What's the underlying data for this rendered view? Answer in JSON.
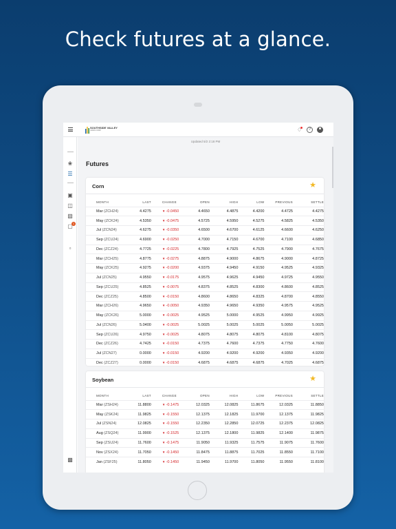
{
  "headline": "Check futures at a glance.",
  "app": {
    "logo_text": "SOUTHSIDE VALLEY",
    "logo_sub": "GRAIN CORP.",
    "updated": "Updated 5/2 2:18 PM",
    "page_title": "Futures"
  },
  "colors": {
    "accent": "#1462a6",
    "negative": "#d3272b",
    "star": "#f2b824",
    "badge": "#e0551f"
  },
  "icons": {
    "topbar": [
      "menu-icon",
      "bell-icon",
      "help-icon",
      "user-icon"
    ],
    "sidenav": [
      "leaf-icon",
      "chart-bars-icon",
      "calendar-icon",
      "book-icon",
      "silo-icon",
      "inbox-icon",
      "contract-icon",
      "document-icon"
    ]
  },
  "sidenav": {
    "badge_count": "1"
  },
  "columns": [
    "MONTH",
    "LAST",
    "CHANGE",
    "OPEN",
    "HIGH",
    "LOW",
    "PREVIOUS",
    "SETTLE"
  ],
  "corn": {
    "title": "Corn",
    "rows": [
      {
        "m": "Mar",
        "c": "(ZCH24)",
        "last": "4.4275",
        "chg": "-0.0450",
        "open": "4.4650",
        "high": "4.4875",
        "low": "4.4200",
        "prev": "4.4725",
        "settle": "4.4275"
      },
      {
        "m": "May",
        "c": "(ZCK24)",
        "last": "4.5350",
        "chg": "-0.0475",
        "open": "4.5725",
        "high": "4.5950",
        "low": "4.5275",
        "prev": "4.5825",
        "settle": "4.5350"
      },
      {
        "m": "Jul",
        "c": "(ZCN24)",
        "last": "4.6275",
        "chg": "-0.0350",
        "open": "4.6500",
        "high": "4.6700",
        "low": "4.6125",
        "prev": "4.6600",
        "settle": "4.6250"
      },
      {
        "m": "Sep",
        "c": "(ZCU24)",
        "last": "4.6900",
        "chg": "-0.0250",
        "open": "4.7000",
        "high": "4.7150",
        "low": "4.6700",
        "prev": "4.7100",
        "settle": "4.6850"
      },
      {
        "m": "Dec",
        "c": "(ZCZ24)",
        "last": "4.7725",
        "chg": "-0.0225",
        "open": "4.7800",
        "high": "4.7925",
        "low": "4.7525",
        "prev": "4.7900",
        "settle": "4.7675"
      },
      {
        "m": "Mar",
        "c": "(ZCH25)",
        "last": "4.8775",
        "chg": "-0.0275",
        "open": "4.8875",
        "high": "4.9000",
        "low": "4.8675",
        "prev": "4.9000",
        "settle": "4.8725"
      },
      {
        "m": "May",
        "c": "(ZCK25)",
        "last": "4.9275",
        "chg": "-0.0200",
        "open": "4.9375",
        "high": "4.9450",
        "low": "4.9150",
        "prev": "4.9525",
        "settle": "4.9325"
      },
      {
        "m": "Jul",
        "c": "(ZCN25)",
        "last": "4.9550",
        "chg": "-0.0175",
        "open": "4.9575",
        "high": "4.9625",
        "low": "4.9450",
        "prev": "4.9725",
        "settle": "4.9550"
      },
      {
        "m": "Sep",
        "c": "(ZCU25)",
        "last": "4.8525",
        "chg": "-0.0075",
        "open": "4.8375",
        "high": "4.8525",
        "low": "4.8300",
        "prev": "4.8600",
        "settle": "4.8525"
      },
      {
        "m": "Dec",
        "c": "(ZCZ25)",
        "last": "4.8500",
        "chg": "-0.0150",
        "open": "4.8600",
        "high": "4.8650",
        "low": "4.8325",
        "prev": "4.8700",
        "settle": "4.8550"
      },
      {
        "m": "Mar",
        "c": "(ZCH26)",
        "last": "4.9650",
        "chg": "-0.0050",
        "open": "4.9350",
        "high": "4.9650",
        "low": "4.9350",
        "prev": "4.9575",
        "settle": "4.9525"
      },
      {
        "m": "May",
        "c": "(ZCK26)",
        "last": "5.0000",
        "chg": "-0.0025",
        "open": "4.9525",
        "high": "5.0000",
        "low": "4.9525",
        "prev": "4.9950",
        "settle": "4.9925"
      },
      {
        "m": "Jul",
        "c": "(ZCN26)",
        "last": "5.0400",
        "chg": "-0.0025",
        "open": "5.0025",
        "high": "5.0025",
        "low": "5.0025",
        "prev": "5.0050",
        "settle": "5.0025"
      },
      {
        "m": "Sep",
        "c": "(ZCU26)",
        "last": "4.9750",
        "chg": "-0.0025",
        "open": "4.8075",
        "high": "4.8075",
        "low": "4.8075",
        "prev": "4.8100",
        "settle": "4.8075"
      },
      {
        "m": "Dec",
        "c": "(ZCZ26)",
        "last": "4.7425",
        "chg": "-0.0150",
        "open": "4.7375",
        "high": "4.7600",
        "low": "4.7375",
        "prev": "4.7750",
        "settle": "4.7600"
      },
      {
        "m": "Jul",
        "c": "(ZCN27)",
        "last": "0.0000",
        "chg": "-0.0150",
        "open": "4.9200",
        "high": "4.9200",
        "low": "4.9200",
        "prev": "4.9350",
        "settle": "4.9200"
      },
      {
        "m": "Dec",
        "c": "(ZCZ27)",
        "last": "0.0000",
        "chg": "-0.0150",
        "open": "4.6875",
        "high": "4.6875",
        "low": "4.6875",
        "prev": "4.7025",
        "settle": "4.6875"
      }
    ]
  },
  "soybean": {
    "title": "Soybean",
    "rows": [
      {
        "m": "Mar",
        "c": "(ZSH24)",
        "last": "11.8800",
        "chg": "-0.1475",
        "open": "12.0325",
        "high": "12.0825",
        "low": "11.8675",
        "prev": "12.0325",
        "settle": "11.8850"
      },
      {
        "m": "May",
        "c": "(ZSK24)",
        "last": "11.9825",
        "chg": "-0.1550",
        "open": "12.1375",
        "high": "12.1825",
        "low": "11.9700",
        "prev": "12.1375",
        "settle": "11.9825"
      },
      {
        "m": "Jul",
        "c": "(ZSN24)",
        "last": "12.0825",
        "chg": "-0.1550",
        "open": "12.2350",
        "high": "12.2850",
        "low": "12.0725",
        "prev": "12.2375",
        "settle": "12.0825"
      },
      {
        "m": "Aug",
        "c": "(ZSQ24)",
        "last": "11.9900",
        "chg": "-0.1525",
        "open": "12.1375",
        "high": "12.1800",
        "low": "11.9825",
        "prev": "12.1400",
        "settle": "11.9875"
      },
      {
        "m": "Sep",
        "c": "(ZSU24)",
        "last": "11.7600",
        "chg": "-0.1475",
        "open": "11.9050",
        "high": "11.9325",
        "low": "11.7575",
        "prev": "11.9075",
        "settle": "11.7600"
      },
      {
        "m": "Nov",
        "c": "(ZSX24)",
        "last": "11.7050",
        "chg": "-0.1450",
        "open": "11.8475",
        "high": "11.8875",
        "low": "11.7025",
        "prev": "11.8550",
        "settle": "11.7100"
      },
      {
        "m": "Jan",
        "c": "(ZSF25)",
        "last": "11.8050",
        "chg": "-0.1450",
        "open": "11.9450",
        "high": "11.9700",
        "low": "11.8050",
        "prev": "11.9550",
        "settle": "11.8100"
      }
    ]
  }
}
